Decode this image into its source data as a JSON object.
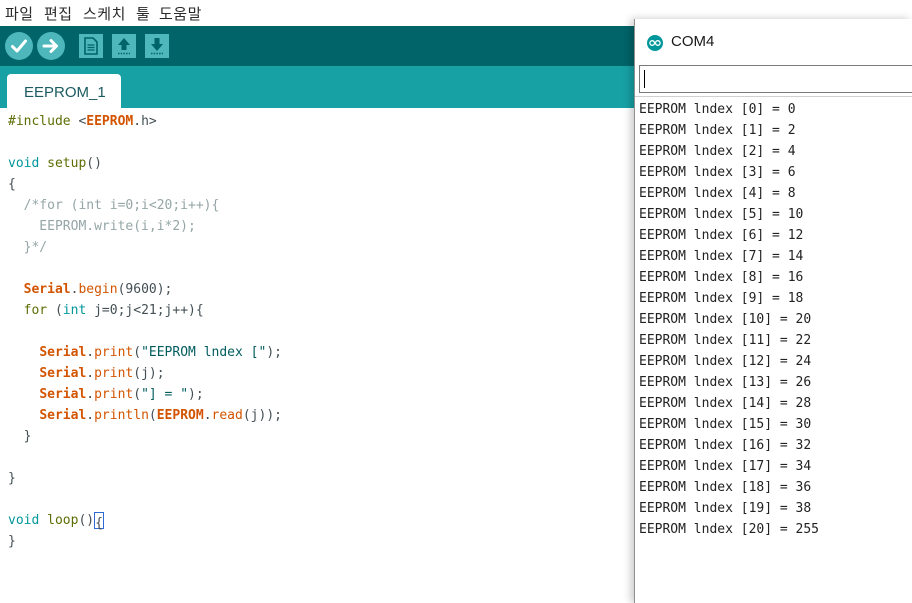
{
  "menu": {
    "items": [
      "파일",
      "편집",
      "스케치",
      "툴",
      "도움말"
    ]
  },
  "toolbar": {
    "buttons": [
      "verify-icon",
      "upload-icon",
      "new-file-icon",
      "open-icon",
      "save-icon"
    ],
    "colors": {
      "bar": "#006468",
      "button": "#4db7bb",
      "tabbar": "#17a1a5"
    }
  },
  "tabs": [
    {
      "label": "EEPROM_1",
      "active": true
    }
  ],
  "code": {
    "lines": [
      "#include <EEPROM.h>",
      "",
      "void setup()",
      "{",
      "  /*for (int i=0;i<20;i++){",
      "    EEPROM.write(i,i*2);",
      "  }*/",
      "",
      "  Serial.begin(9600);",
      "  for (int j=0;j<21;j++){",
      "",
      "    Serial.print(\"EEPROM lndex [\");",
      "    Serial.print(j);",
      "    Serial.print(\"] = \");",
      "    Serial.println(EEPROM.read(j));",
      "  }",
      "",
      "}",
      "",
      "void loop(){",
      "}"
    ]
  },
  "serial_monitor": {
    "title": "COM4",
    "input_value": "",
    "output": [
      "EEPROM lndex [0] = 0",
      "EEPROM lndex [1] = 2",
      "EEPROM lndex [2] = 4",
      "EEPROM lndex [3] = 6",
      "EEPROM lndex [4] = 8",
      "EEPROM lndex [5] = 10",
      "EEPROM lndex [6] = 12",
      "EEPROM lndex [7] = 14",
      "EEPROM lndex [8] = 16",
      "EEPROM lndex [9] = 18",
      "EEPROM lndex [10] = 20",
      "EEPROM lndex [11] = 22",
      "EEPROM lndex [12] = 24",
      "EEPROM lndex [13] = 26",
      "EEPROM lndex [14] = 28",
      "EEPROM lndex [15] = 30",
      "EEPROM lndex [16] = 32",
      "EEPROM lndex [17] = 34",
      "EEPROM lndex [18] = 36",
      "EEPROM lndex [19] = 38",
      "EEPROM lndex [20] = 255"
    ]
  }
}
